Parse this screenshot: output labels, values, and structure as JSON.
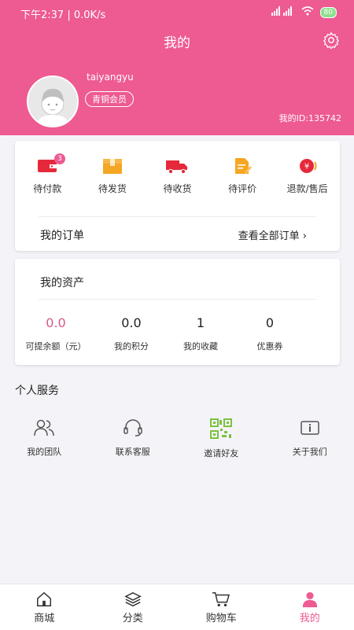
{
  "status": {
    "time": "下午2:37",
    "speed": "0.0K/s",
    "battery": "80"
  },
  "header": {
    "title": "我的",
    "username": "taiyangyu",
    "member_level": "青铜会员",
    "user_id": "我的ID:135742"
  },
  "orders": {
    "items": [
      {
        "label": "待付款",
        "badge": "3"
      },
      {
        "label": "待发货"
      },
      {
        "label": "待收货"
      },
      {
        "label": "待评价"
      },
      {
        "label": "退款/售后"
      }
    ],
    "title": "我的订单",
    "view_all": "查看全部订单 ›"
  },
  "assets": {
    "title": "我的资产",
    "items": [
      {
        "value": "0.0",
        "label": "可提余额（元）"
      },
      {
        "value": "0.0",
        "label": "我的积分"
      },
      {
        "value": "1",
        "label": "我的收藏"
      },
      {
        "value": "0",
        "label": "优惠券"
      }
    ]
  },
  "services": {
    "title": "个人服务",
    "items": [
      {
        "label": "我的团队"
      },
      {
        "label": "联系客服"
      },
      {
        "label": "邀请好友"
      },
      {
        "label": "关于我们"
      }
    ]
  },
  "tabs": [
    {
      "label": "商城"
    },
    {
      "label": "分类"
    },
    {
      "label": "购物车"
    },
    {
      "label": "我的"
    }
  ],
  "colors": {
    "brand": "#ee5a92",
    "asset_highlight": "#d45a8a"
  }
}
